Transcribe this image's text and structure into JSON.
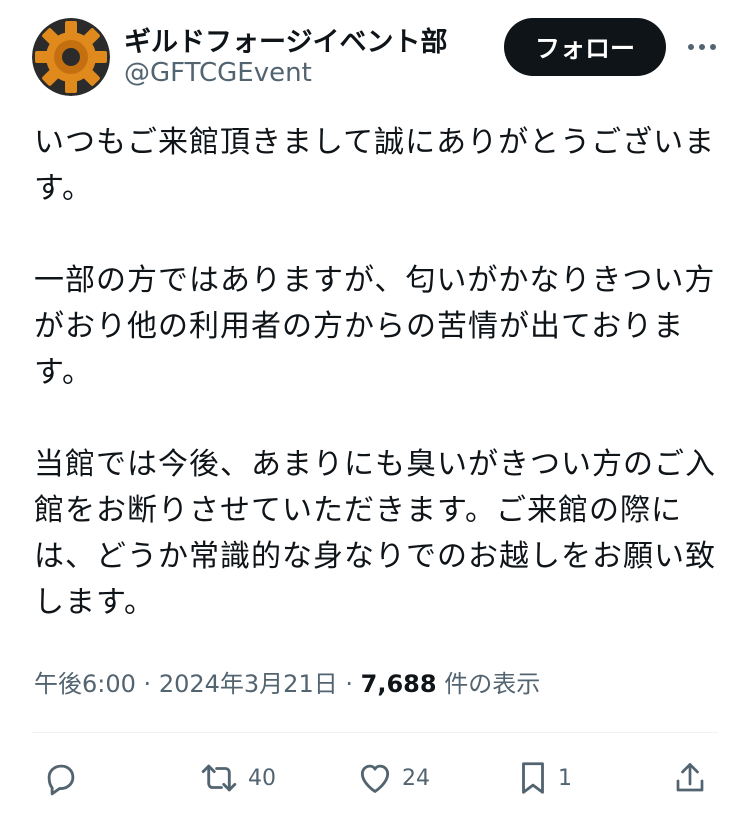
{
  "author": {
    "name": "ギルドフォージイベント部",
    "handle": "@GFTCGEvent",
    "avatar_icon": "gear-logo-icon",
    "avatar_color": "#e08a1e"
  },
  "follow_label": "フォロー",
  "more_icon": "more-icon",
  "tweet": {
    "lines_p1": [
      "いつもご来館頂きまして誠にありがとうございま",
      "す。"
    ],
    "lines_p2": [
      "一部の方ではありますが、匂いがかなりきつい方",
      "がおり他の利用者の方からの苦情が出ておりま",
      "す。"
    ],
    "lines_p3": [
      "当館では今後、あまりにも臭いがきつい方のご入",
      "館をお断りさせていただきます。ご来館の際に",
      "は、どうか常識的な身なりでのお越しをお願い致",
      "します。"
    ]
  },
  "meta": {
    "time": "午後6:00",
    "sep": "·",
    "date": "2024年3月21日",
    "views_count": "7,688",
    "views_label": "件の表示"
  },
  "actions": {
    "reply": {
      "icon": "reply-icon",
      "count": ""
    },
    "retweet": {
      "icon": "retweet-icon",
      "count": "40"
    },
    "like": {
      "icon": "heart-icon",
      "count": "24"
    },
    "bookmark": {
      "icon": "bookmark-icon",
      "count": "1"
    },
    "share": {
      "icon": "share-icon",
      "count": ""
    }
  }
}
